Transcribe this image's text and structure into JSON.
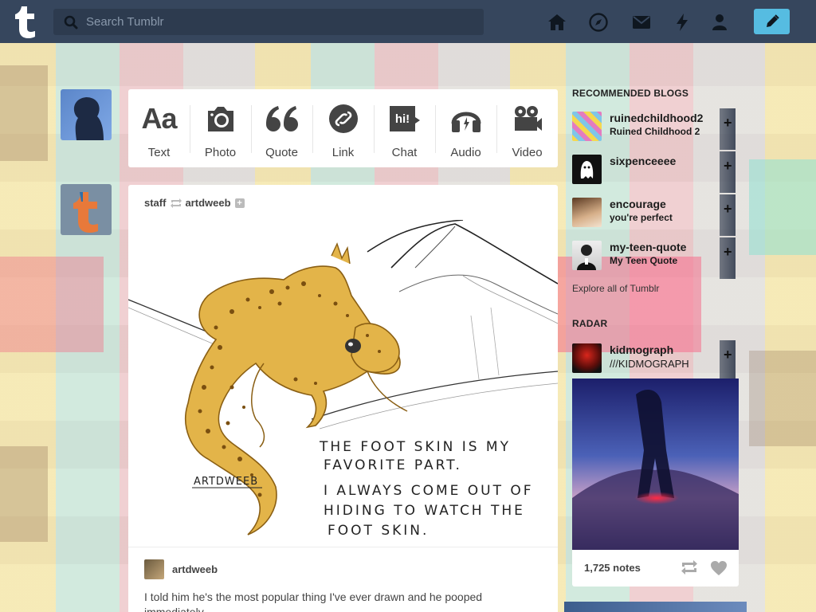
{
  "header": {
    "search_placeholder": "Search Tumblr",
    "nav_icons": [
      "home-icon",
      "explore-icon",
      "inbox-icon",
      "activity-icon",
      "account-icon"
    ],
    "compose_icon": "pencil-icon"
  },
  "post_types": [
    {
      "label": "Text",
      "icon": "text-icon",
      "glyph": "Aa"
    },
    {
      "label": "Photo",
      "icon": "camera-icon"
    },
    {
      "label": "Quote",
      "icon": "quote-icon"
    },
    {
      "label": "Link",
      "icon": "link-icon"
    },
    {
      "label": "Chat",
      "icon": "chat-icon",
      "glyph": "hi!"
    },
    {
      "label": "Audio",
      "icon": "headphones-icon"
    },
    {
      "label": "Video",
      "icon": "video-camera-icon"
    }
  ],
  "post": {
    "reblogged_by": "staff",
    "source_blog": "artdweeb",
    "art_signature": "ARTDWEEB",
    "art_text_lines": [
      "THE FOOT SKIN IS MY",
      "FAVORITE PART.",
      "I ALWAYS COME OUT OF",
      "HIDING TO WATCH THE",
      "FOOT SKIN."
    ],
    "reblog_author": "artdweeb",
    "caption": "I told him he's the most popular thing I've ever drawn and he pooped immediately."
  },
  "sidebar": {
    "recommended_heading": "RECOMMENDED BLOGS",
    "recommended": [
      {
        "name": "ruinedchildhood2",
        "title": "Ruined Childhood 2"
      },
      {
        "name": "sixpenceeee",
        "title": ""
      },
      {
        "name": "encourage",
        "title": "you're perfect"
      },
      {
        "name": "my-teen-quote",
        "title": "My Teen Quote"
      }
    ],
    "explore_link": "Explore all of Tumblr",
    "radar_heading": "RADAR",
    "radar": {
      "name": "kidmograph",
      "title": "///KIDMOGRAPH",
      "notes": "1,725 notes"
    }
  },
  "colors": {
    "header_bg": "#36465d",
    "search_bg": "#2d3b4f",
    "compose_bg": "#56bce1",
    "gecko": "#e3b449"
  }
}
